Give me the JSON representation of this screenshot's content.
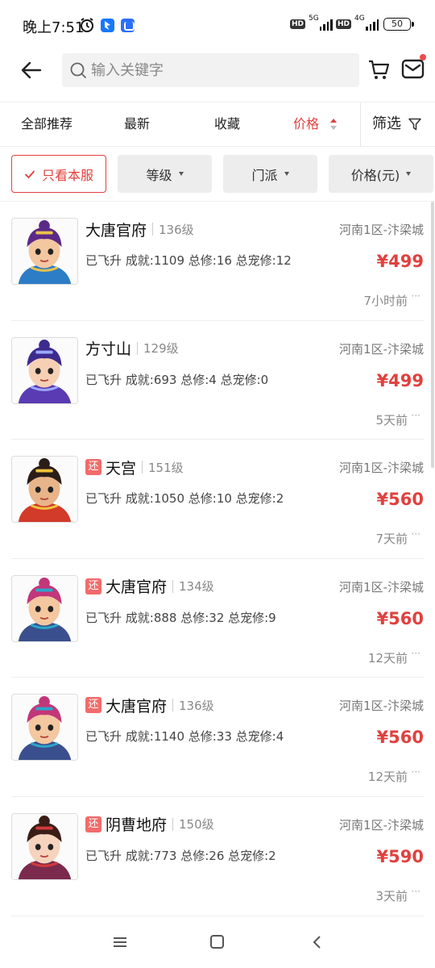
{
  "status_bar": {
    "time": "晚上7:51",
    "network1": "5G",
    "network2": "4G",
    "hd": "HD",
    "battery": "50"
  },
  "search": {
    "placeholder": "输入关键字"
  },
  "tabs": [
    {
      "label": "全部推荐"
    },
    {
      "label": "最新"
    },
    {
      "label": "收藏"
    },
    {
      "label": "价格"
    }
  ],
  "filter": {
    "label": "筛选"
  },
  "chips": {
    "server_only": "只看本服",
    "level": "等级",
    "school": "门派",
    "price": "价格(元)"
  },
  "listings": [
    {
      "returned": false,
      "sect": "大唐官府",
      "level": "136级",
      "server": "河南1区-汴梁城",
      "stats": "已飞升 成就:1109 总修:16 总宠修:12",
      "price": "¥499",
      "time": "7小时前"
    },
    {
      "returned": false,
      "sect": "方寸山",
      "level": "129级",
      "server": "河南1区-汴梁城",
      "stats": "已飞升 成就:693 总修:4 总宠修:0",
      "price": "¥499",
      "time": "5天前"
    },
    {
      "returned": true,
      "badge": "还",
      "sect": "天宫",
      "level": "151级",
      "server": "河南1区-汴梁城",
      "stats": "已飞升 成就:1050 总修:10 总宠修:2",
      "price": "¥560",
      "time": "7天前"
    },
    {
      "returned": true,
      "badge": "还",
      "sect": "大唐官府",
      "level": "134级",
      "server": "河南1区-汴梁城",
      "stats": "已飞升 成就:888 总修:32 总宠修:9",
      "price": "¥560",
      "time": "12天前"
    },
    {
      "returned": true,
      "badge": "还",
      "sect": "大唐官府",
      "level": "136级",
      "server": "河南1区-汴梁城",
      "stats": "已飞升 成就:1140 总修:33 总宠修:4",
      "price": "¥560",
      "time": "12天前"
    },
    {
      "returned": true,
      "badge": "还",
      "sect": "阴曹地府",
      "level": "150级",
      "server": "河南1区-汴梁城",
      "stats": "已飞升 成就:773 总修:26 总宠修:2",
      "price": "¥590",
      "time": "3天前"
    }
  ],
  "colors": {
    "accent": "#e0413e",
    "badge": "#f26b6b"
  }
}
